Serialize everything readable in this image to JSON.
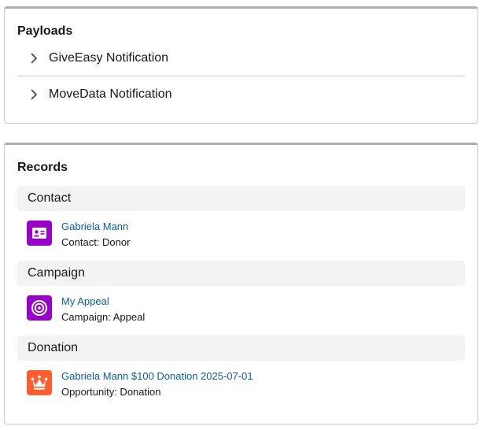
{
  "payloads": {
    "title": "Payloads",
    "items": [
      {
        "label": "GiveEasy Notification",
        "icon": "chevron-right-icon"
      },
      {
        "label": "MoveData Notification",
        "icon": "chevron-right-icon"
      }
    ]
  },
  "records": {
    "title": "Records",
    "sections": [
      {
        "header": "Contact",
        "record": {
          "name": "Gabriela Mann",
          "type_line": "Contact: Donor",
          "icon": "contact-card-icon",
          "icon_color": "#9602c7"
        }
      },
      {
        "header": "Campaign",
        "record": {
          "name": "My Appeal",
          "type_line": "Campaign: Appeal",
          "icon": "campaign-target-icon",
          "icon_color": "#9602c7"
        }
      },
      {
        "header": "Donation",
        "record": {
          "name": "Gabriela Mann $100 Donation 2025-07-01",
          "type_line": "Opportunity: Donation",
          "icon": "opportunity-crown-icon",
          "icon_color": "#ff5d2d"
        }
      }
    ]
  },
  "colors": {
    "link": "#0b5cab",
    "section_bg": "#f3f3f3",
    "border": "#c9c9c9"
  }
}
